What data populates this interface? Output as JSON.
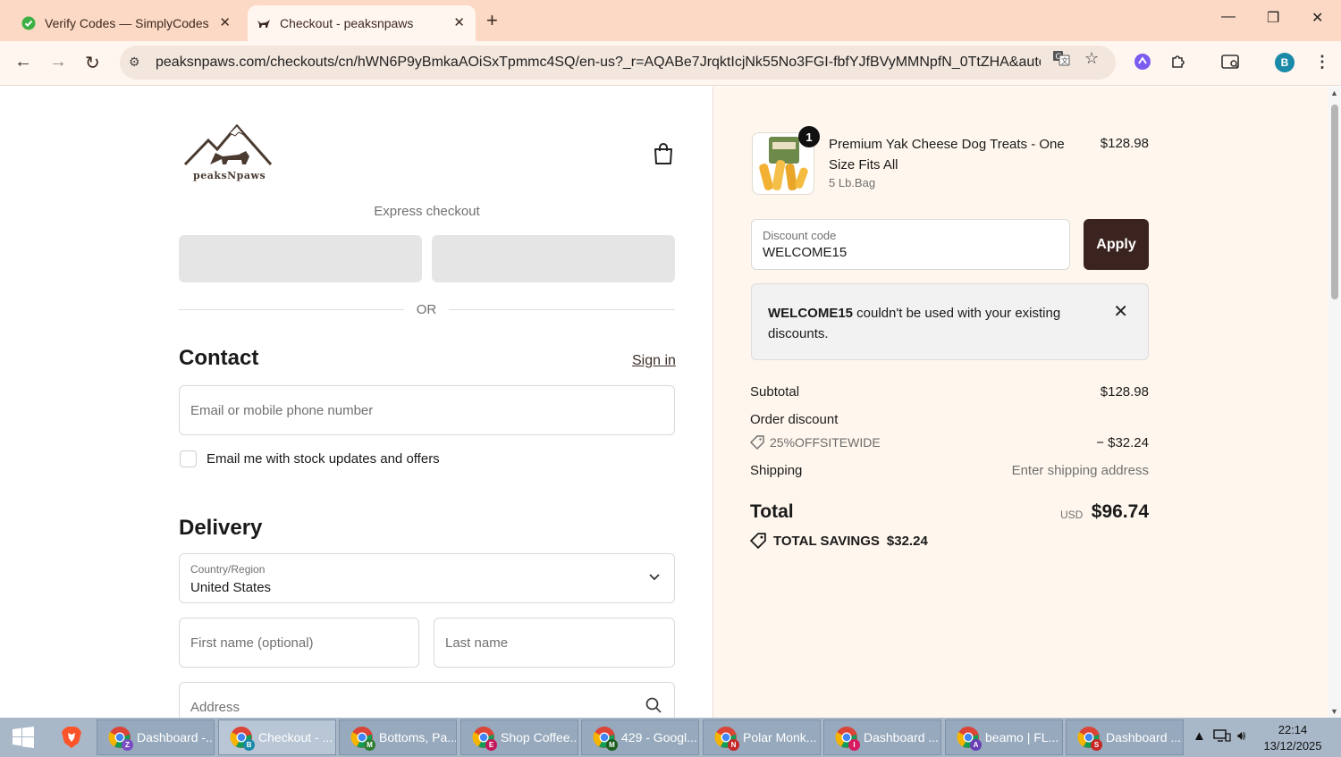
{
  "browser": {
    "tabs": [
      {
        "title": "Verify Codes — SimplyCodes",
        "active": false
      },
      {
        "title": "Checkout - peaksnpaws",
        "active": true
      }
    ],
    "url": "peaksnpaws.com/checkouts/cn/hWN6P9yBmkaAOiSxTpmmc4SQ/en-us?_r=AQABe7JrqktIcjNk55No3FGI-fbfYJfBVyMMNpfN_0TtZHA&auto_redir...",
    "profile_initial": "B"
  },
  "checkout": {
    "brand": "peaksNpaws",
    "express_label": "Express checkout",
    "or_label": "OR",
    "contact": {
      "heading": "Contact",
      "signin_label": "Sign in",
      "email_placeholder": "Email or mobile phone number",
      "marketing_label": "Email me with stock updates and offers"
    },
    "delivery": {
      "heading": "Delivery",
      "country_label": "Country/Region",
      "country_value": "United States",
      "first_name_placeholder": "First name (optional)",
      "last_name_placeholder": "Last name",
      "address_placeholder": "Address"
    }
  },
  "summary": {
    "item": {
      "quantity": "1",
      "name": "Premium Yak Cheese Dog Treats - One Size Fits All",
      "variant": "5 Lb.Bag",
      "price": "$128.98"
    },
    "discount": {
      "label": "Discount code",
      "value": "WELCOME15",
      "apply_label": "Apply"
    },
    "notice": {
      "code": "WELCOME15",
      "message": " couldn't be used with your existing discounts."
    },
    "subtotal_label": "Subtotal",
    "subtotal_value": "$128.98",
    "order_discount_label": "Order discount",
    "discount_code_applied": "25%OFFSITEWIDE",
    "discount_amount": "− $32.24",
    "shipping_label": "Shipping",
    "shipping_value": "Enter shipping address",
    "total_label": "Total",
    "currency": "USD",
    "total_value": "$96.74",
    "savings_label": "TOTAL SAVINGS",
    "savings_value": "$32.24"
  },
  "taskbar": {
    "items": [
      {
        "label": "Dashboard -...",
        "badge": "Z",
        "badge_color": "#7b4cc2"
      },
      {
        "label": "Checkout - ...",
        "badge": "B",
        "badge_color": "#1a8aa8"
      },
      {
        "label": "Bottoms, Pa...",
        "badge": "M",
        "badge_color": "#2e7d32"
      },
      {
        "label": "Shop Coffee...",
        "badge": "E",
        "badge_color": "#c2185b"
      },
      {
        "label": "429 - Googl...",
        "badge": "M",
        "badge_color": "#1b5e20"
      },
      {
        "label": "Polar Monk...",
        "badge": "N",
        "badge_color": "#c62828"
      },
      {
        "label": "Dashboard ...",
        "badge": "I",
        "badge_color": "#d81b60"
      },
      {
        "label": "beamo | FL...",
        "badge": "A",
        "badge_color": "#6a3fb5"
      },
      {
        "label": "Dashboard ...",
        "badge": "S",
        "badge_color": "#c62828"
      }
    ],
    "time": "22:14",
    "date": "13/12/2025"
  }
}
